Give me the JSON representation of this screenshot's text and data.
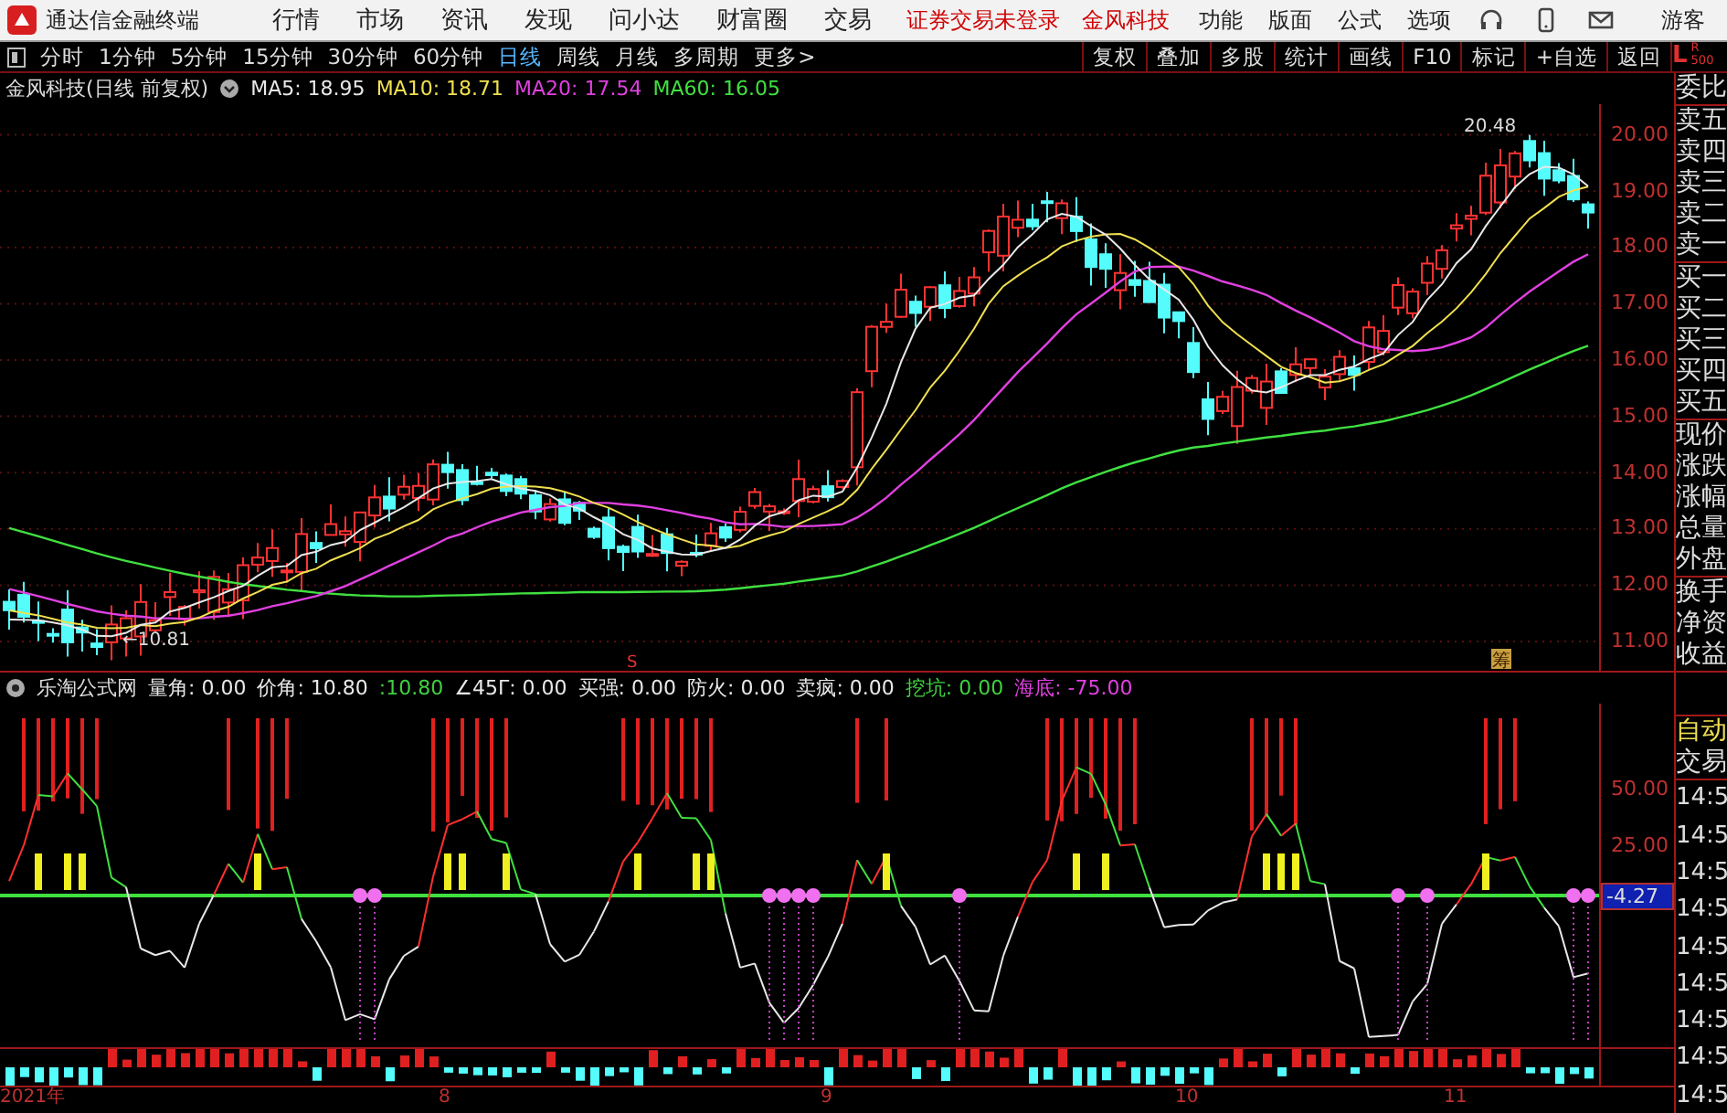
{
  "title_bar": {
    "app_name": "通达信金融终端",
    "menu": [
      "行情",
      "市场",
      "资讯",
      "发现",
      "问小达",
      "财富圈",
      "交易"
    ],
    "notice": [
      "证券交易未登录",
      "金风科技"
    ],
    "tools": [
      "功能",
      "版面",
      "公式",
      "选项"
    ],
    "user": "游客"
  },
  "period_tabs": [
    {
      "label": "分时",
      "selected": false
    },
    {
      "label": "1分钟",
      "selected": false
    },
    {
      "label": "5分钟",
      "selected": false
    },
    {
      "label": "15分钟",
      "selected": false
    },
    {
      "label": "30分钟",
      "selected": false
    },
    {
      "label": "60分钟",
      "selected": false
    },
    {
      "label": "日线",
      "selected": true
    },
    {
      "label": "周线",
      "selected": false
    },
    {
      "label": "月线",
      "selected": false
    },
    {
      "label": "多周期",
      "selected": false
    },
    {
      "label": "更多>",
      "selected": false
    }
  ],
  "tool_buttons": [
    "复权",
    "叠加",
    "多股",
    "统计",
    "画线",
    "F10",
    "标记",
    "+自选",
    "返回"
  ],
  "level_badge": {
    "letter": "L",
    "r": "R",
    "depth": "500"
  },
  "price_chart": {
    "title": "金风科技(日线 前复权)",
    "legend": [
      {
        "text": "MA5: 18.95",
        "color": "#e8e8e8"
      },
      {
        "text": "MA10: 18.71",
        "color": "#f0e050"
      },
      {
        "text": "MA20: 17.54",
        "color": "#e040e0"
      },
      {
        "text": "MA60: 16.05",
        "color": "#40e040"
      }
    ],
    "axis_labels": [
      "20.00",
      "19.00",
      "18.00",
      "17.00",
      "16.00",
      "15.00",
      "14.00",
      "13.00",
      "12.00",
      "11.00"
    ],
    "annotations": [
      {
        "kind": "high",
        "text": "20.48"
      },
      {
        "kind": "low",
        "text": "←10.81"
      }
    ],
    "markers": [
      {
        "kind": "s",
        "text": "S"
      },
      {
        "kind": "chip",
        "text": "筹"
      }
    ]
  },
  "indicator": {
    "name": "乐淘公式网",
    "legend": [
      {
        "text": "量角: 0.00",
        "color": "#e8e8e8"
      },
      {
        "text": "价角: 10.80",
        "color": "#e8e8e8"
      },
      {
        "text": ":10.80",
        "color": "#40d040"
      },
      {
        "text": "∠45Γ: 0.00",
        "color": "#e8e8e8"
      },
      {
        "text": "买强: 0.00",
        "color": "#e8e8e8"
      },
      {
        "text": "防火: 0.00",
        "color": "#e8e8e8"
      },
      {
        "text": "卖疯: 0.00",
        "color": "#e8e8e8"
      },
      {
        "text": "挖坑: 0.00",
        "color": "#40d040"
      },
      {
        "text": "海底: -75.00",
        "color": "#e040e0"
      }
    ],
    "axis_labels": [
      "50.00",
      "25.00"
    ],
    "current_value": "-4.27"
  },
  "date_axis": [
    "2021年",
    "8",
    "9",
    "10",
    "11"
  ],
  "quote_panel": {
    "groups": [
      [
        "委比"
      ],
      [
        "卖五",
        "卖四",
        "卖三",
        "卖二",
        "卖一"
      ],
      [
        "买一",
        "买二",
        "买三",
        "买四",
        "买五"
      ],
      [
        "现价",
        "涨跌",
        "涨幅",
        "总量",
        "外盘"
      ],
      [
        "换手",
        "净资",
        "收益"
      ]
    ],
    "mode": "自动",
    "trade_label": "交易",
    "times": [
      "14:5",
      "14:5",
      "14:5",
      "14:5",
      "14:5",
      "14:5",
      "14:5",
      "14:5",
      "14:5"
    ]
  }
}
